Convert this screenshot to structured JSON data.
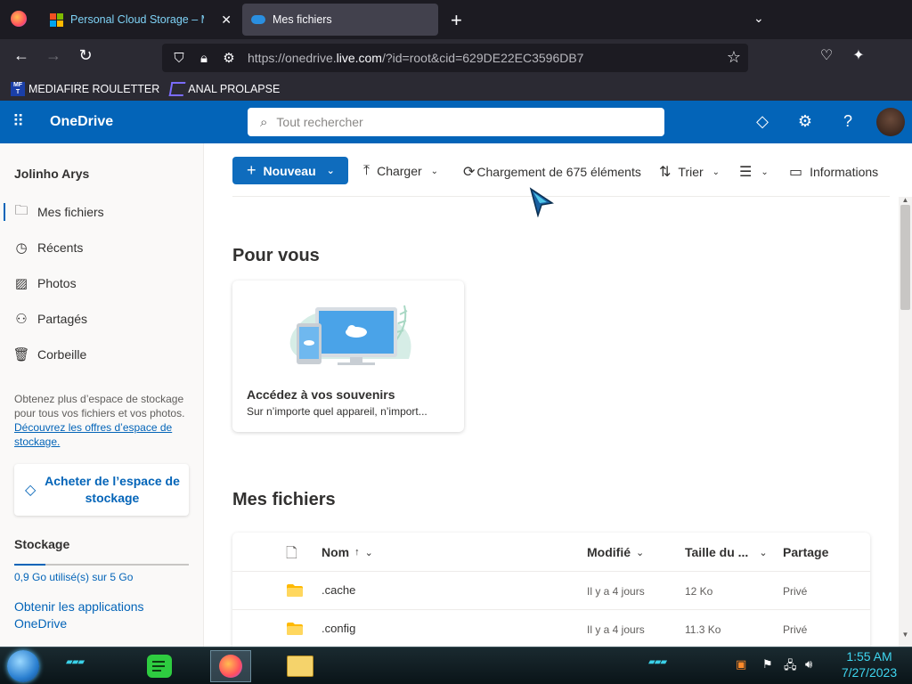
{
  "browser": {
    "tabs": [
      {
        "title": "Personal Cloud Storage – Micr",
        "active": false
      },
      {
        "title": "Mes fichiers",
        "active": true
      }
    ],
    "url_prefix": "https://onedrive.",
    "url_domain": "live.com",
    "url_suffix": "/?id=root&cid=629DE22EC3596DB7",
    "bookmarks": [
      {
        "label": "MEDIAFIRE ROULETTER"
      },
      {
        "label": "ANAL PROLAPSE"
      }
    ]
  },
  "header": {
    "app_name": "OneDrive",
    "search_placeholder": "Tout rechercher"
  },
  "sidebar": {
    "user_name": "Jolinho Arys",
    "items": [
      {
        "label": "Mes fichiers",
        "icon": "folder-icon",
        "selected": true
      },
      {
        "label": "Récents",
        "icon": "history-icon",
        "selected": false
      },
      {
        "label": "Photos",
        "icon": "photo-icon",
        "selected": false
      },
      {
        "label": "Partagés",
        "icon": "people-icon",
        "selected": false
      },
      {
        "label": "Corbeille",
        "icon": "recycle-bin-icon",
        "selected": false
      }
    ],
    "promo_text": "Obtenez plus d’espace de stockage pour tous vos fichiers et vos photos.",
    "promo_link": "Découvrez les offres d’espace de stockage.",
    "buy_button": "Acheter de l’espace de stockage",
    "storage_title": "Stockage",
    "storage_used_text": "0,9 Go utilisé(s) sur 5 Go",
    "storage_used_fraction": 0.18,
    "get_apps": "Obtenir les applications OneDrive"
  },
  "commandbar": {
    "new_label": "Nouveau",
    "upload_label": "Charger",
    "loading_label": "Chargement de 675 éléments",
    "sort_label": "Trier",
    "info_label": "Informations"
  },
  "main": {
    "for_you_title": "Pour vous",
    "card_title": "Accédez à vos souvenirs",
    "card_subtitle": "Sur n’importe quel appareil, n’import...",
    "my_files_title": "Mes fichiers",
    "columns": {
      "name": "Nom",
      "name_sort": "↑",
      "modified": "Modifié",
      "size": "Taille du ...",
      "sharing": "Partage"
    },
    "rows": [
      {
        "name": ".cache",
        "modified": "Il y a 4 jours",
        "size": "12 Ko",
        "sharing": "Privé"
      },
      {
        "name": ".config",
        "modified": "Il y a 4 jours",
        "size": "11.3 Ko",
        "sharing": "Privé"
      }
    ]
  },
  "taskbar": {
    "time": "1:55 AM",
    "date": "7/27/2023"
  },
  "colors": {
    "brand": "#0364b8",
    "primary_button": "#0f6cbd",
    "browser_dark": "#1c1b22"
  }
}
